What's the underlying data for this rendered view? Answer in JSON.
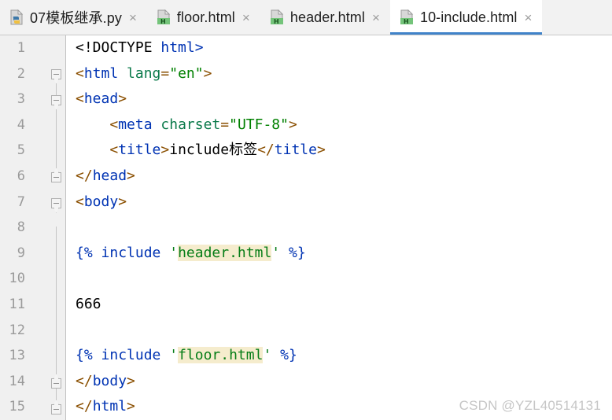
{
  "window": {
    "accent_color": "#4083c9",
    "tabbar_bg": "#f2f2f2",
    "gutter_bg": "#f0f0f0",
    "editor_bg": "#ffffff",
    "highlight_color": "#f5eccd"
  },
  "tabs": [
    {
      "label": "07模板继承.py",
      "icon": "python-file-icon",
      "close": "×",
      "active": false
    },
    {
      "label": "floor.html",
      "icon": "html-file-icon",
      "close": "×",
      "active": false
    },
    {
      "label": "header.html",
      "icon": "html-file-icon",
      "close": "×",
      "active": false
    },
    {
      "label": "10-include.html",
      "icon": "html-file-icon",
      "close": "×",
      "active": true
    }
  ],
  "editor": {
    "line_numbers": [
      "1",
      "2",
      "3",
      "4",
      "5",
      "6",
      "7",
      "8",
      "9",
      "10",
      "11",
      "12",
      "13",
      "14",
      "15"
    ],
    "lines": [
      {
        "n": "1",
        "text": "<!DOCTYPE html>"
      },
      {
        "n": "2",
        "text": "<html lang=\"en\">"
      },
      {
        "n": "3",
        "text": "<head>"
      },
      {
        "n": "4",
        "text": "    <meta charset=\"UTF-8\">"
      },
      {
        "n": "5",
        "text": "    <title>include标签</title>"
      },
      {
        "n": "6",
        "text": "</head>"
      },
      {
        "n": "7",
        "text": "<body>"
      },
      {
        "n": "8",
        "text": ""
      },
      {
        "n": "9",
        "text": "{% include 'header.html' %}"
      },
      {
        "n": "10",
        "text": ""
      },
      {
        "n": "11",
        "text": "666"
      },
      {
        "n": "12",
        "text": ""
      },
      {
        "n": "13",
        "text": "{% include 'floor.html' %}"
      },
      {
        "n": "14",
        "text": "</body>"
      },
      {
        "n": "15",
        "text": "</html>"
      }
    ],
    "tokens": {
      "doctype_open": "<!DOCTYPE",
      "doctype_name": " html>",
      "lt": "<",
      "lt_slash": "</",
      "gt": ">",
      "tag_html": "html",
      "tag_head": "head",
      "tag_body": "body",
      "tag_meta": "meta",
      "tag_title": "title",
      "attr_lang": " lang",
      "attr_charset": " charset",
      "eq": "=",
      "val_en": "\"en\"",
      "val_utf8": "\"UTF-8\"",
      "title_text": "include标签",
      "jinja_open": "{%",
      "jinja_close": "%}",
      "kw_include": " include ",
      "quote": "'",
      "file_header": "header.html",
      "file_floor": "floor.html",
      "plain_666": "666",
      "space": " "
    }
  },
  "watermark": {
    "text": "CSDN @YZL40514131"
  }
}
